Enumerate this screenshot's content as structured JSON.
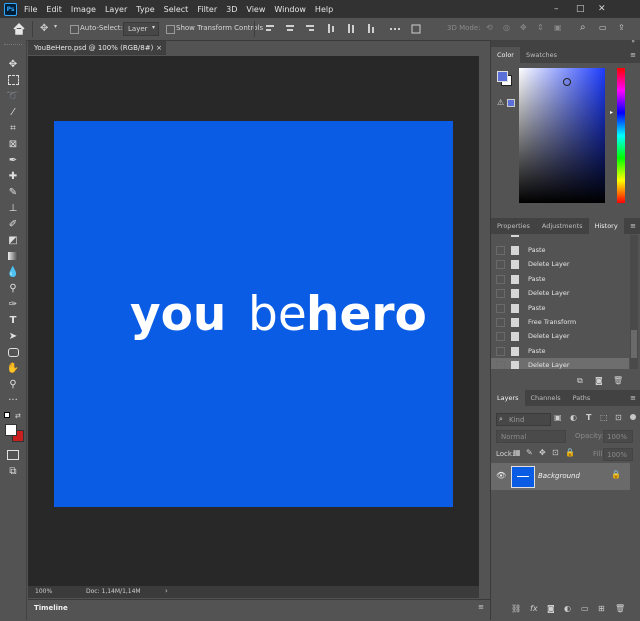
{
  "app": {
    "logo": "Ps"
  },
  "menu": [
    "File",
    "Edit",
    "Image",
    "Layer",
    "Type",
    "Select",
    "Filter",
    "3D",
    "View",
    "Window",
    "Help"
  ],
  "window_controls": {
    "minimize": "–",
    "maximize": "□",
    "close": "✕"
  },
  "options": {
    "auto_select_label": "Auto-Select:",
    "auto_select_value": "Layer",
    "show_transform_label": "Show Transform Controls",
    "mode_3d_label": "3D Mode:"
  },
  "document": {
    "tab_title": "YouBeHero.psd @ 100% (RGB/8#)",
    "tab_close": "×",
    "zoom": "100%",
    "doc_info": "Doc: 1,14M/1,14M",
    "artboard_color": "#0b5ce5",
    "logo_text_parts": [
      "you",
      "be",
      "hero"
    ]
  },
  "timeline": {
    "label": "Timeline"
  },
  "color_panel": {
    "tabs": [
      "Color",
      "Swatches"
    ],
    "fg": "#5a6fd8",
    "bg": "#ffffff"
  },
  "history_panel": {
    "tabs": [
      "Properties",
      "Adjustments",
      "History"
    ],
    "items": [
      "Paste",
      "Delete Layer",
      "Paste",
      "Delete Layer",
      "Paste",
      "Free Transform",
      "Delete Layer",
      "Paste",
      "Delete Layer"
    ],
    "selected_index": 8
  },
  "layers_panel": {
    "tabs": [
      "Layers",
      "Channels",
      "Paths"
    ],
    "filter_placeholder": "Kind",
    "blend_mode": "Normal",
    "opacity_label": "Opacity:",
    "opacity_value": "100%",
    "lock_label": "Lock:",
    "fill_label": "Fill:",
    "fill_value": "100%",
    "layer_name": "Background"
  }
}
